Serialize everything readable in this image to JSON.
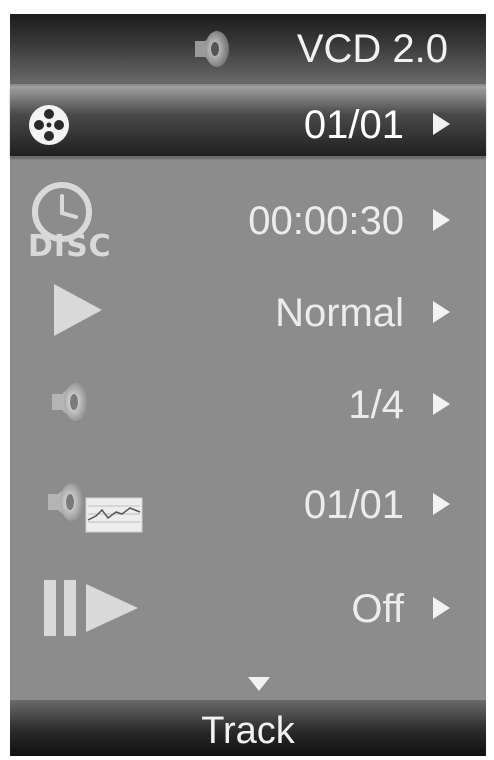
{
  "header": {
    "title": "VCD 2.0",
    "icon": "speaker-icon"
  },
  "rows": [
    {
      "icon": "film-reel-icon",
      "value": "01/01",
      "selected": true
    },
    {
      "icon": "clock-disc-icon",
      "icon_text": "DISC",
      "value": "00:00:30"
    },
    {
      "icon": "play-icon",
      "value": "Normal"
    },
    {
      "icon": "speaker-icon",
      "value": "1/4"
    },
    {
      "icon": "audio-waveform-icon",
      "value": "01/01"
    },
    {
      "icon": "pause-play-icon",
      "value": "Off"
    }
  ],
  "more_indicator": "down-arrow-icon",
  "footer": {
    "label": "Track"
  },
  "colors": {
    "panel": "#8c8c8c",
    "text": "#ececec",
    "header_dark": "#1b1b1b"
  }
}
